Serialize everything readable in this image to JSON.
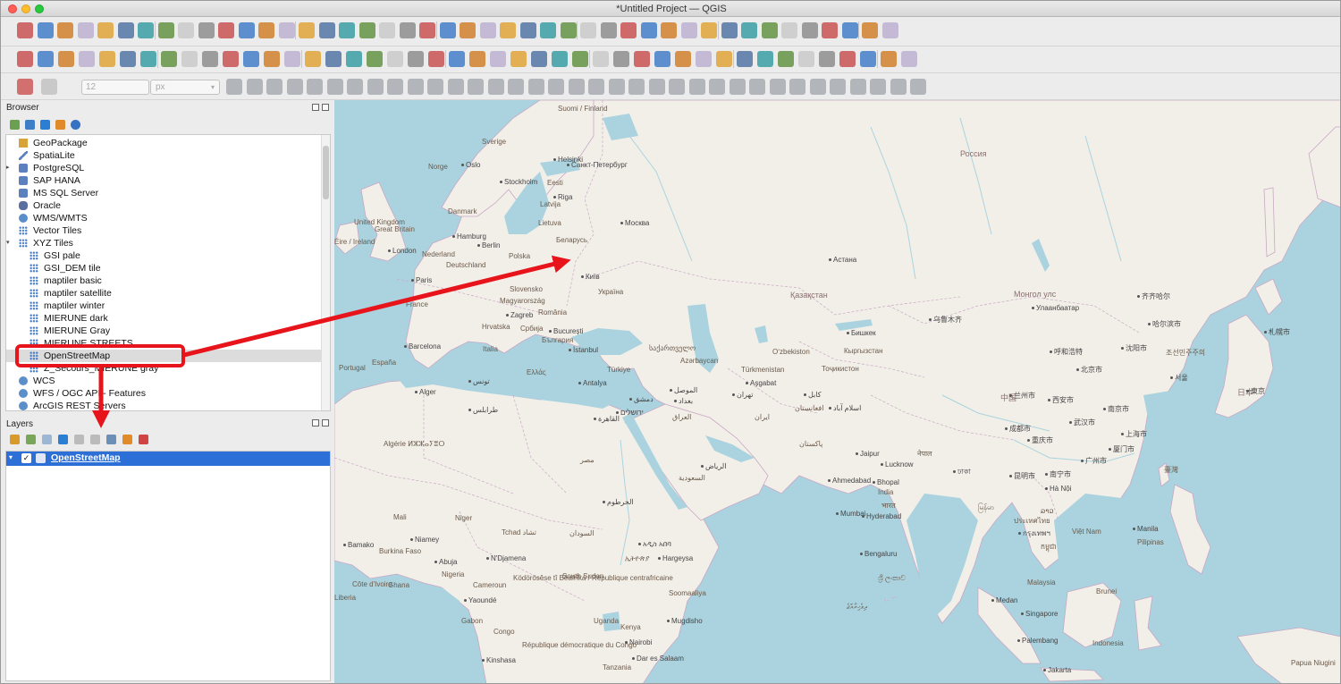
{
  "window": {
    "title": "*Untitled Project — QGIS"
  },
  "colors": {
    "map_water": "#aad3df",
    "map_land": "#f2efe9",
    "selection": "#2c6fd6",
    "annotation": "#e8141b"
  },
  "toolbar3": {
    "size_value": "12",
    "unit_value": "px"
  },
  "browser": {
    "title": "Browser",
    "items": [
      {
        "label": "GeoPackage",
        "icon": "geopackage-icon"
      },
      {
        "label": "SpatiaLite",
        "icon": "spatialite-icon"
      },
      {
        "label": "PostgreSQL",
        "icon": "postgresql-icon"
      },
      {
        "label": "SAP HANA",
        "icon": "database-icon"
      },
      {
        "label": "MS SQL Server",
        "icon": "mssql-icon"
      },
      {
        "label": "Oracle",
        "icon": "oracle-icon"
      },
      {
        "label": "WMS/WMTS",
        "icon": "globe-icon"
      },
      {
        "label": "Vector Tiles",
        "icon": "grid-icon"
      },
      {
        "label": "XYZ Tiles",
        "icon": "grid-icon"
      }
    ],
    "xyz_children": [
      {
        "label": "GSI pale"
      },
      {
        "label": "GSI_DEM tile"
      },
      {
        "label": "maptiler basic"
      },
      {
        "label": "maptiler satellite"
      },
      {
        "label": "maptiler winter"
      },
      {
        "label": "MIERUNE dark"
      },
      {
        "label": "MIERUNE Gray"
      },
      {
        "label": "MIERUNE STREETS"
      },
      {
        "label": "OpenStreetMap"
      },
      {
        "label": "Z_Secours_MIERUNE gray"
      }
    ],
    "after": [
      {
        "label": "WCS",
        "icon": "globe-icon"
      },
      {
        "label": "WFS / OGC API - Features",
        "icon": "globe-icon"
      },
      {
        "label": "ArcGIS REST Servers",
        "icon": "globe-icon"
      }
    ]
  },
  "layers": {
    "title": "Layers",
    "items": [
      {
        "label": "OpenStreetMap",
        "checked": true
      }
    ]
  },
  "map_labels": {
    "Russia": "Россия",
    "Finland": "Suomi / Finland",
    "Sweden": "Sverige",
    "Norway": "Norge",
    "Oslo": "Oslo",
    "Stockholm": "Stockholm",
    "Helsinki": "Helsinki",
    "StPete": "Санкт-Петербург",
    "Eesti": "Eesti",
    "Latvija": "Latvija",
    "Lietuva": "Lietuva",
    "Danmark": "Danmark",
    "Riga": "Riga",
    "Moscow": "Москва",
    "Belarus": "Беларусь",
    "UK": "United Kingdom",
    "GreatBritain": "Great Britain",
    "Ireland": "Éire / Ireland",
    "London": "London",
    "Hamburg": "Hamburg",
    "Berlin": "Berlin",
    "Nederland": "Nederland",
    "Deutschland": "Deutschland",
    "Polska": "Polska",
    "Paris": "Paris",
    "France": "France",
    "Kyiv": "Київ",
    "Ukraine": "Україна",
    "Slovensko": "Slovensko",
    "Magyarorszag": "Magyarország",
    "Zagreb": "Zagreb",
    "Romania": "România",
    "Bucuresti": "București",
    "Hrvatska": "Hrvatska",
    "Srbija": "Србија",
    "Bulgaria": "България",
    "Espana": "España",
    "Portugal": "Portugal",
    "Barcelona": "Barcelona",
    "Italia": "Italia",
    "Istanbul": "İstanbul",
    "Turkiye": "Türkiye",
    "Ellada": "Ελλάς",
    "Antalya": "Antalya",
    "Kazakhstan": "Қазақстан",
    "Astana": "Астана",
    "Uzbekiston": "Oʻzbekiston",
    "Turkmenistan": "Türkmenistan",
    "Ashgabat": "Aşgabat",
    "Bishkek": "Бишкек",
    "Kyrgyzstan": "Кыргызстан",
    "Tojikiston": "Тоҷикистон",
    "Azerbaijan": "Azərbaycan",
    "Georgia": "საქართველო",
    "Algiers": "Alger",
    "Algerie": "Algérie ⵍⵣⵣⴰⵢⴻⵔ",
    "Tunis": "تونس",
    "Tripoli": "طرابلس",
    "Misr": "مصر",
    "Cairo": "القاهرة",
    "Riyadh": "الرياض",
    "Saudi": "السعودية",
    "Tehran": "تهران",
    "Iran": "ایران",
    "Baghdad": "بغداد",
    "Iraq": "العراق",
    "Dimashq": "دمشق",
    "Jerusalem": "ירושלים",
    "Mali": "Mali",
    "Niger": "Niger",
    "Tchad": "Tchad تشاد",
    "Sudan": "السودان",
    "Khartoum": "الخرطوم",
    "Bamako": "Bamako",
    "BurkinaFaso": "Burkina Faso",
    "Niamey": "Niamey",
    "Nigeria": "Nigeria",
    "Abuja": "Abuja",
    "NDjamena": "N'Djamena",
    "Cameroun": "Cameroun",
    "Yaounde": "Yaoundé",
    "CAR": "Ködörösêse tî Bêafrîka / République centrafricaine",
    "SouthSudan": "South Sudan",
    "Ethiopia": "ኢትዮጵያ",
    "AddisAbaba": "አዲስ አበባ",
    "Hargeysa": "Hargeysa",
    "Somaliya": "Soomaaliya",
    "Muqdisho": "Mugdisho",
    "Kenya": "Kenya",
    "Uganda": "Uganda",
    "Nairobi": "Nairobi",
    "DRC": "République démocratique du Congo",
    "Kinshasa": "Kinshasa",
    "Gabon": "Gabon",
    "Congo": "Congo",
    "Tanzania": "Tanzania",
    "Dares": "Dar es Salaam",
    "CoteIvoire": "Côte d'Ivoire",
    "Ghana": "Ghana",
    "Liberia": "Liberia",
    "India": "India",
    "Bharat": "भारत",
    "Lucknow": "Lucknow",
    "Bhopal": "Bhopal",
    "Ahmedabad": "Ahmedabad",
    "Mumbai": "Mumbai",
    "Hyderabad": "Hyderabad",
    "Bengaluru": "Bengaluru",
    "Jaipur": "Jaipur",
    "Pakistan": "پاکستان",
    "Islamabad": "اسلام آباد",
    "Nepal": "नेपाल",
    "Dhaka": "ঢাকা",
    "SriLanka": "ශ්‍රී ලංකාව",
    "Maldives": "ދިވެހިރާއްޖެ",
    "China": "中国",
    "Beijing": "北京市",
    "Shanghai": "上海市",
    "Urumqi": "乌鲁木齐",
    "Qiqihar": "齐齐哈尔",
    "Harbin": "哈尔滨市",
    "Shenyang": "沈阳市",
    "Hohhot": "呼和浩特",
    "Lanzhou": "兰州市",
    "Xian": "西安市",
    "Chengdu": "成都市",
    "Chongqing": "重庆市",
    "Wuhan": "武汉市",
    "Nanjing": "南京市",
    "Guangzhou": "广州市",
    "Kunming": "昆明市",
    "Nanning": "南宁市",
    "Xiamen": "厦门市",
    "Mongolia": "Монгол улс",
    "Ulaanbaatar": "Улаанбаатар",
    "Korea": "조선민주주의",
    "Seoul": "서울",
    "Nippon": "日本",
    "Tokyo": "東京",
    "Sapporo": "札幌市",
    "Hanoi": "Hà Nội",
    "VietNam": "Việt Nam",
    "Bangkok": "กรุงเทพฯ",
    "Thailand": "ประเทศไทย",
    "Myanmar": "မြန်မာ",
    "Laos": "ລາວ",
    "Cambodia": "កម្ពុជា",
    "Taiwan": "臺灣",
    "Philippines": "Pilipinas",
    "Manila": "Manila",
    "Malaysia": "Malaysia",
    "Singapore": "Singapore",
    "Medan": "Medan",
    "Palembang": "Palembang",
    "Jakarta": "Jakarta",
    "Indonesia": "Indonesia",
    "Brunei": "Brunei",
    "PapuaNewGuinea": "Papua Niugini",
    "Mosul": "الموصل",
    "Kabul": "کابل",
    "Afghanistan": "افغانستان"
  }
}
